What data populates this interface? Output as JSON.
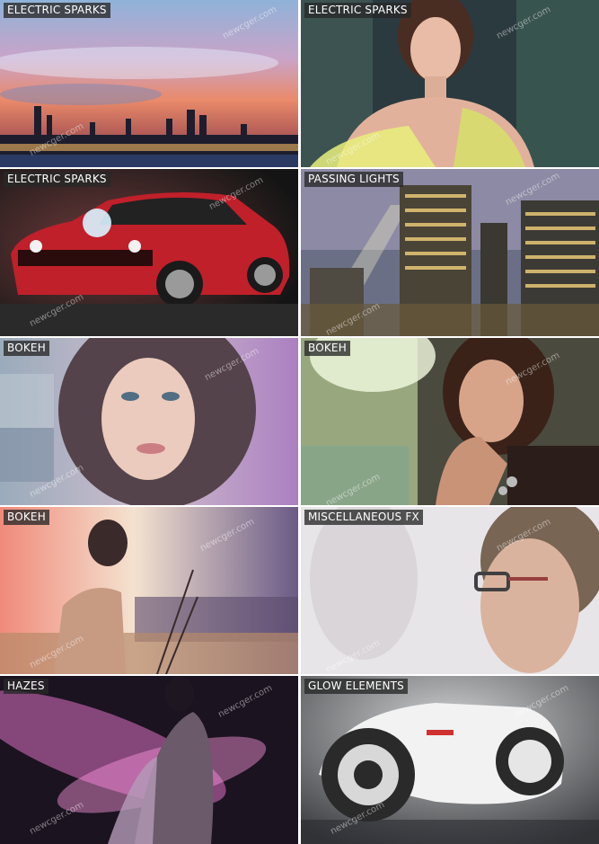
{
  "watermark": "newcger.com",
  "tiles": [
    {
      "label": "ELECTRIC SPARKS"
    },
    {
      "label": "ELECTRIC SPARKS"
    },
    {
      "label": "ELECTRIC SPARKS"
    },
    {
      "label": "PASSING LIGHTS"
    },
    {
      "label": "BOKEH"
    },
    {
      "label": "BOKEH"
    },
    {
      "label": "BOKEH"
    },
    {
      "label": "MISCELLANEOUS FX"
    },
    {
      "label": "HAZES"
    },
    {
      "label": "GLOW ELEMENTS"
    }
  ]
}
